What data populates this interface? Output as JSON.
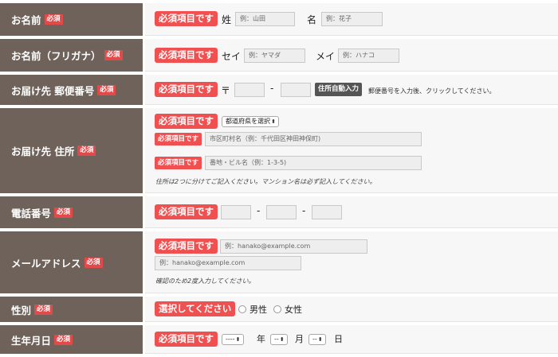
{
  "required_tag": "必須",
  "required_item": "必須項目です",
  "select_prompt": "選択してください",
  "rows": {
    "name": {
      "label": "お名前",
      "sei_label": "姓",
      "sei_placeholder": "例：山田",
      "mei_label": "名",
      "mei_placeholder": "例：花子"
    },
    "kana": {
      "label": "お名前（フリガナ）",
      "sei_label": "セイ",
      "sei_placeholder": "例：ヤマダ",
      "mei_label": "メイ",
      "mei_placeholder": "例：ハナコ"
    },
    "zip": {
      "label": "お届け先 郵便番号",
      "prefix": "〒",
      "dash": "-",
      "auto_button": "住所自動入力",
      "hint": "郵便番号を入力後、クリックしてください。"
    },
    "address": {
      "label": "お届け先 住所",
      "pref_select": "都道府県を選択",
      "city_placeholder": "市区町村名（例：千代田区神田神保町)",
      "street_placeholder": "番地・ビル名（例：1-3-5)",
      "note": "住所は2つに分けてご記入ください。マンション名は必ず記入してください。"
    },
    "phone": {
      "label": "電話番号",
      "dash1": "-",
      "dash2": "-"
    },
    "email": {
      "label": "メールアドレス",
      "placeholder1": "例：hanako@example.com",
      "placeholder2": "例：hanako@example.com",
      "note": "確認のため2度入力してください。"
    },
    "gender": {
      "label": "性別",
      "male": "男性",
      "female": "女性"
    },
    "birthday": {
      "label": "生年月日",
      "year_select": "----",
      "year_label": "年",
      "month_select": "--",
      "month_label": "月",
      "day_select": "--",
      "day_label": "日"
    }
  }
}
